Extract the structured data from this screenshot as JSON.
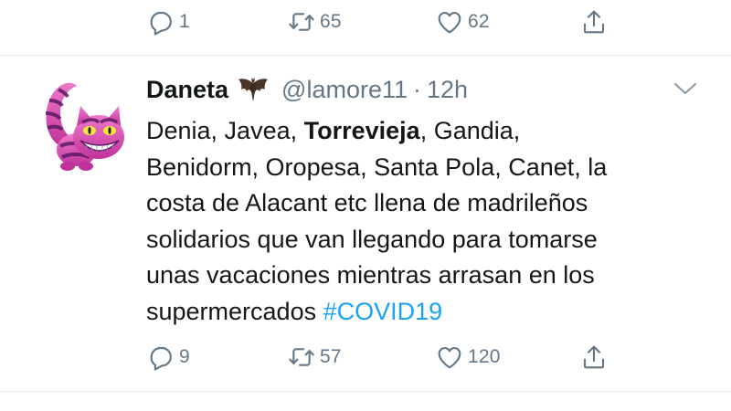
{
  "prev_tweet": {
    "actions": {
      "reply_count": "1",
      "retweet_count": "65",
      "like_count": "62"
    }
  },
  "tweet": {
    "display_name": "Daneta",
    "name_emoji": "bat-emoji",
    "handle": "@lamore11",
    "separator": "·",
    "time": "12h",
    "text_lines": [
      {
        "a": "Denia, Javea, ",
        "b": "Torrevieja",
        "c": ", Gandia,"
      },
      {
        "a": "Benidorm, Oropesa, Santa Pola, Canet, la"
      },
      {
        "a": "costa de Alacant etc llena de madrileños"
      },
      {
        "a": "solidarios que van llegando para tomarse"
      },
      {
        "a": "unas vacaciones mientras arrasan en los"
      },
      {
        "a": "supermercados ",
        "hashtag": "#COVID19"
      }
    ],
    "actions": {
      "reply_count": "9",
      "retweet_count": "57",
      "like_count": "120"
    }
  },
  "colors": {
    "text": "#14171a",
    "muted": "#657786",
    "hashtag": "#1da1f2",
    "divider": "#e6ecf0"
  },
  "icons": [
    "reply-icon",
    "retweet-icon",
    "like-icon",
    "share-icon",
    "chevron-down-icon",
    "bat-emoji",
    "cheshire-cat-avatar"
  ]
}
